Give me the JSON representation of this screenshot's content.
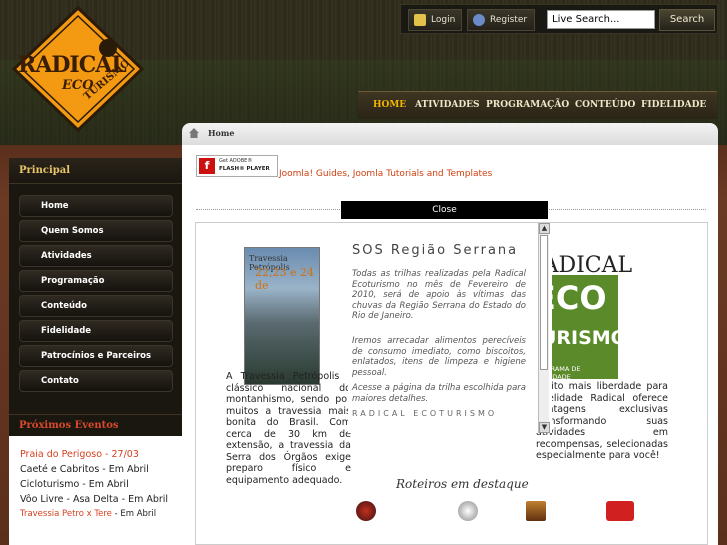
{
  "logo": {
    "line1": "RADICAL",
    "line2": "ECO",
    "line3": "TURISMO"
  },
  "topbar": {
    "login": "Login",
    "register": "Register",
    "search_value": "Live Search...",
    "search_button": "Search"
  },
  "nav": {
    "items": [
      "HOME",
      "ATIVIDADES",
      "PROGRAMAÇÃO",
      "CONTEÚDO",
      "FIDELIDADE"
    ]
  },
  "breadcrumb": {
    "label": "Home"
  },
  "sidebar": {
    "title": "Principal",
    "items": [
      "Home",
      "Quem Somos",
      "Atividades",
      "Programação",
      "Conteúdo",
      "Fidelidade",
      "Patrocínios e Parceiros",
      "Contato"
    ],
    "events_title": "Próximos Eventos",
    "events": [
      {
        "name": "Praia do Perigoso - 27/03",
        "red": true,
        "suffix": ""
      },
      {
        "name": "Caeté e Cabritos - Em Abril",
        "red": false,
        "suffix": ""
      },
      {
        "name": "Cicloturismo - Em Abril",
        "red": false,
        "suffix": ""
      },
      {
        "name": "Vôo Livre - Asa Delta - Em Abril",
        "red": false,
        "suffix": ""
      },
      {
        "name": "Travessia Petro x Tere",
        "red": true,
        "suffix": " - Em Abril"
      }
    ]
  },
  "flash": {
    "line1": "Get ADOBE®",
    "line2": "FLASH® PLAYER"
  },
  "joomla_link": "Joomla! Guides, Joomla Tutorials and Templates",
  "close_label": "Close",
  "poster": {
    "title": "Travessia Petrópolis",
    "date": "22,23 e 24 de"
  },
  "popup": {
    "title": "SOS Região Serrana",
    "p1": "Todas as trilhas realizadas pela Radical Ecoturismo no mês de Fevereiro de 2010, será de apoio às vítimas das chuvas da Região Serrana do Estado do Rio de Janeiro.",
    "p2": "Iremos arrecadar alimentos perecíveis de consumo imediato, como biscoitos, enlatados, itens de limpeza e higiene pessoal.",
    "p3": "Acesse a página da trilha escolhida para maiores detalhes.",
    "footer": "RADICAL ECOTURISMO"
  },
  "logo2": {
    "rad": "RADICAL",
    "eco": "ECO",
    "turismo": "TURISMO",
    "fid": "PROGRAMA DE FIDELIDADE"
  },
  "body_text": {
    "t1": "A Travessia Petrópolis - clássico nacional do montanhismo, sendo por muitos a travessia mais bonita do Brasil. Com cerca de 30 km de extensão, a travessia da Serra dos Órgãos exige preparo físico e equipamento adequado.",
    "t3": "muito mais liberdade para fidelidade Radical oferece vantagens exclusivas transformando suas atividades em recompensas, selecionadas especialmente para você!"
  },
  "roteiros": {
    "title": "Roteiros em destaque"
  }
}
